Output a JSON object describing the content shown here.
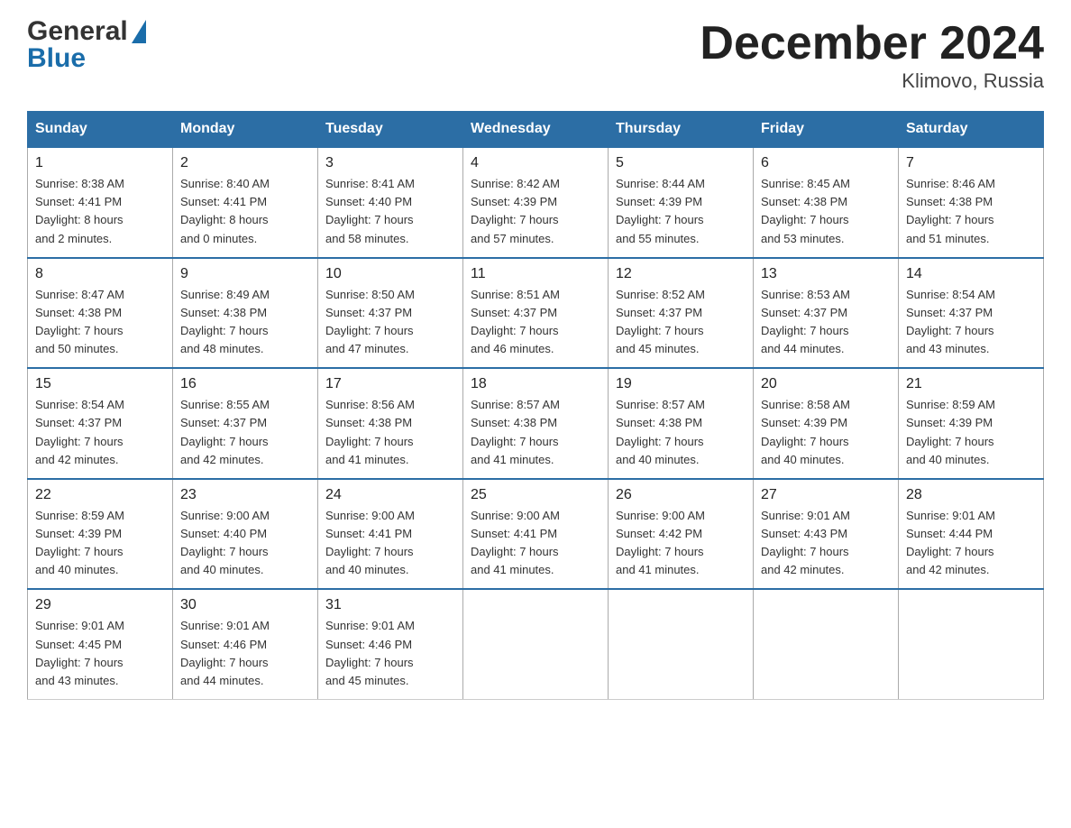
{
  "header": {
    "logo_general": "General",
    "logo_blue": "Blue",
    "title": "December 2024",
    "subtitle": "Klimovo, Russia"
  },
  "columns": [
    "Sunday",
    "Monday",
    "Tuesday",
    "Wednesday",
    "Thursday",
    "Friday",
    "Saturday"
  ],
  "weeks": [
    [
      {
        "day": "1",
        "info": "Sunrise: 8:38 AM\nSunset: 4:41 PM\nDaylight: 8 hours\nand 2 minutes."
      },
      {
        "day": "2",
        "info": "Sunrise: 8:40 AM\nSunset: 4:41 PM\nDaylight: 8 hours\nand 0 minutes."
      },
      {
        "day": "3",
        "info": "Sunrise: 8:41 AM\nSunset: 4:40 PM\nDaylight: 7 hours\nand 58 minutes."
      },
      {
        "day": "4",
        "info": "Sunrise: 8:42 AM\nSunset: 4:39 PM\nDaylight: 7 hours\nand 57 minutes."
      },
      {
        "day": "5",
        "info": "Sunrise: 8:44 AM\nSunset: 4:39 PM\nDaylight: 7 hours\nand 55 minutes."
      },
      {
        "day": "6",
        "info": "Sunrise: 8:45 AM\nSunset: 4:38 PM\nDaylight: 7 hours\nand 53 minutes."
      },
      {
        "day": "7",
        "info": "Sunrise: 8:46 AM\nSunset: 4:38 PM\nDaylight: 7 hours\nand 51 minutes."
      }
    ],
    [
      {
        "day": "8",
        "info": "Sunrise: 8:47 AM\nSunset: 4:38 PM\nDaylight: 7 hours\nand 50 minutes."
      },
      {
        "day": "9",
        "info": "Sunrise: 8:49 AM\nSunset: 4:38 PM\nDaylight: 7 hours\nand 48 minutes."
      },
      {
        "day": "10",
        "info": "Sunrise: 8:50 AM\nSunset: 4:37 PM\nDaylight: 7 hours\nand 47 minutes."
      },
      {
        "day": "11",
        "info": "Sunrise: 8:51 AM\nSunset: 4:37 PM\nDaylight: 7 hours\nand 46 minutes."
      },
      {
        "day": "12",
        "info": "Sunrise: 8:52 AM\nSunset: 4:37 PM\nDaylight: 7 hours\nand 45 minutes."
      },
      {
        "day": "13",
        "info": "Sunrise: 8:53 AM\nSunset: 4:37 PM\nDaylight: 7 hours\nand 44 minutes."
      },
      {
        "day": "14",
        "info": "Sunrise: 8:54 AM\nSunset: 4:37 PM\nDaylight: 7 hours\nand 43 minutes."
      }
    ],
    [
      {
        "day": "15",
        "info": "Sunrise: 8:54 AM\nSunset: 4:37 PM\nDaylight: 7 hours\nand 42 minutes."
      },
      {
        "day": "16",
        "info": "Sunrise: 8:55 AM\nSunset: 4:37 PM\nDaylight: 7 hours\nand 42 minutes."
      },
      {
        "day": "17",
        "info": "Sunrise: 8:56 AM\nSunset: 4:38 PM\nDaylight: 7 hours\nand 41 minutes."
      },
      {
        "day": "18",
        "info": "Sunrise: 8:57 AM\nSunset: 4:38 PM\nDaylight: 7 hours\nand 41 minutes."
      },
      {
        "day": "19",
        "info": "Sunrise: 8:57 AM\nSunset: 4:38 PM\nDaylight: 7 hours\nand 40 minutes."
      },
      {
        "day": "20",
        "info": "Sunrise: 8:58 AM\nSunset: 4:39 PM\nDaylight: 7 hours\nand 40 minutes."
      },
      {
        "day": "21",
        "info": "Sunrise: 8:59 AM\nSunset: 4:39 PM\nDaylight: 7 hours\nand 40 minutes."
      }
    ],
    [
      {
        "day": "22",
        "info": "Sunrise: 8:59 AM\nSunset: 4:39 PM\nDaylight: 7 hours\nand 40 minutes."
      },
      {
        "day": "23",
        "info": "Sunrise: 9:00 AM\nSunset: 4:40 PM\nDaylight: 7 hours\nand 40 minutes."
      },
      {
        "day": "24",
        "info": "Sunrise: 9:00 AM\nSunset: 4:41 PM\nDaylight: 7 hours\nand 40 minutes."
      },
      {
        "day": "25",
        "info": "Sunrise: 9:00 AM\nSunset: 4:41 PM\nDaylight: 7 hours\nand 41 minutes."
      },
      {
        "day": "26",
        "info": "Sunrise: 9:00 AM\nSunset: 4:42 PM\nDaylight: 7 hours\nand 41 minutes."
      },
      {
        "day": "27",
        "info": "Sunrise: 9:01 AM\nSunset: 4:43 PM\nDaylight: 7 hours\nand 42 minutes."
      },
      {
        "day": "28",
        "info": "Sunrise: 9:01 AM\nSunset: 4:44 PM\nDaylight: 7 hours\nand 42 minutes."
      }
    ],
    [
      {
        "day": "29",
        "info": "Sunrise: 9:01 AM\nSunset: 4:45 PM\nDaylight: 7 hours\nand 43 minutes."
      },
      {
        "day": "30",
        "info": "Sunrise: 9:01 AM\nSunset: 4:46 PM\nDaylight: 7 hours\nand 44 minutes."
      },
      {
        "day": "31",
        "info": "Sunrise: 9:01 AM\nSunset: 4:46 PM\nDaylight: 7 hours\nand 45 minutes."
      },
      {
        "day": "",
        "info": ""
      },
      {
        "day": "",
        "info": ""
      },
      {
        "day": "",
        "info": ""
      },
      {
        "day": "",
        "info": ""
      }
    ]
  ]
}
